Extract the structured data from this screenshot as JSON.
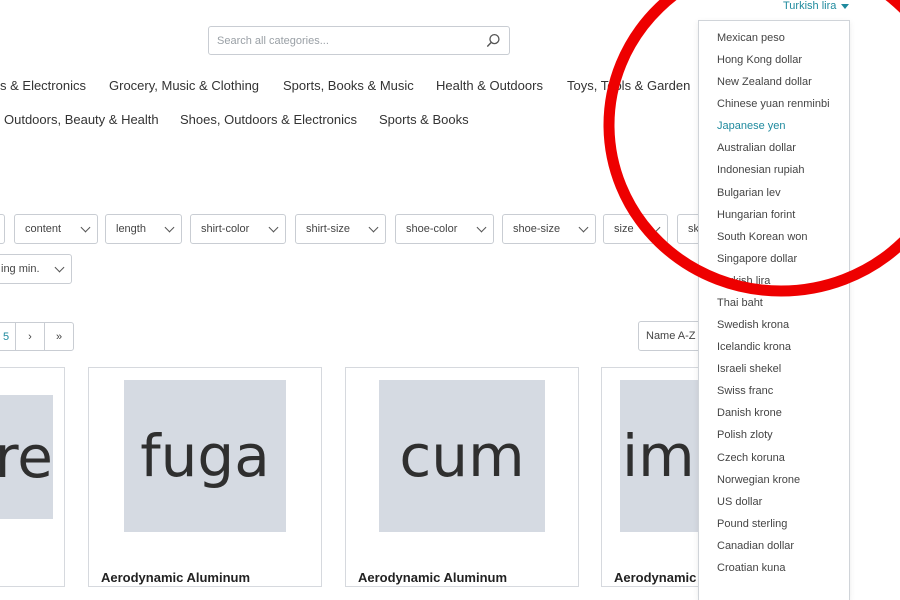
{
  "header": {
    "search_placeholder": "Search all categories...",
    "currency_selected": "Turkish lira"
  },
  "nav": {
    "row1": [
      "s & Electronics",
      "Grocery, Music & Clothing",
      "Sports, Books & Music",
      "Health & Outdoors",
      "Toys, Tools & Garden"
    ],
    "row2": [
      "Outdoors, Beauty & Health",
      "Shoes, Outdoors & Electronics",
      "Sports & Books"
    ]
  },
  "filters": {
    "row1": [
      "content",
      "length",
      "shirt-color",
      "shirt-size",
      "shoe-color",
      "shoe-size",
      "size",
      "sk"
    ],
    "row2": [
      "ing min."
    ]
  },
  "pagination": {
    "last_page": "5",
    "next": "›",
    "last": "»"
  },
  "sort": {
    "label": "Name A-Z"
  },
  "products": [
    {
      "thumb_text": "re",
      "title": ""
    },
    {
      "thumb_text": "fuga",
      "title": "Aerodynamic Aluminum"
    },
    {
      "thumb_text": "cum",
      "title": "Aerodynamic Aluminum"
    },
    {
      "thumb_text": "imp",
      "title": "Aerodynamic"
    }
  ],
  "currency_dropdown": {
    "active": "Japanese yen",
    "options": [
      "Mexican peso",
      "Hong Kong dollar",
      "New Zealand dollar",
      "Chinese yuan renminbi",
      "Japanese yen",
      "Australian dollar",
      "Indonesian rupiah",
      "Bulgarian lev",
      "Hungarian forint",
      "South Korean won",
      "Singapore dollar",
      "Turkish lira",
      "Thai baht",
      "Swedish krona",
      "Icelandic krona",
      "Israeli shekel",
      "Swiss franc",
      "Danish krone",
      "Polish zloty",
      "Czech koruna",
      "Norwegian krone",
      "US dollar",
      "Pound sterling",
      "Canadian dollar",
      "Croatian kuna"
    ]
  },
  "colors": {
    "accent": "#1f8a9e",
    "annotation": "#ee0000",
    "thumb_bg": "#d5dae2"
  },
  "icons": {
    "search": "search-icon",
    "currency_caret": "caret-down-icon",
    "filter_chevron": "chevron-down-icon"
  }
}
